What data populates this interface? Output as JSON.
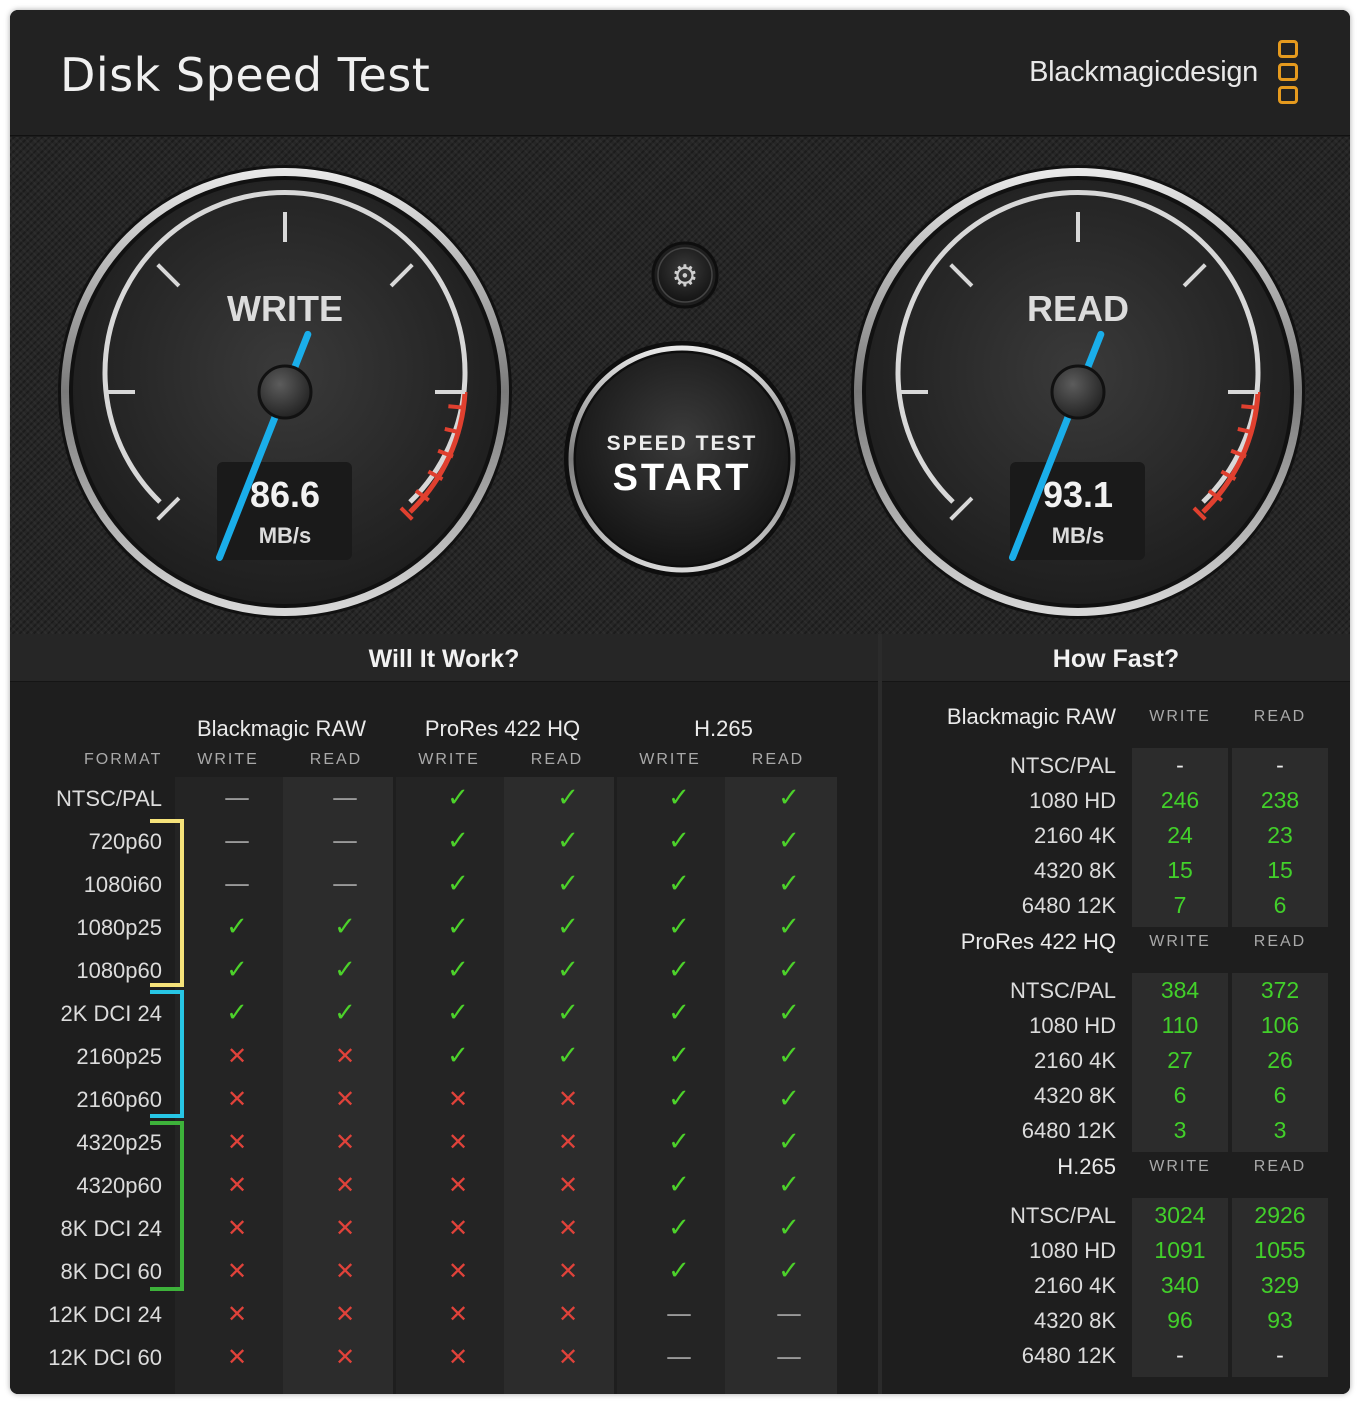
{
  "window": {
    "title": "Disk Speed Test",
    "brand": "Blackmagicdesign",
    "close_label": "✕"
  },
  "gauges": {
    "write": {
      "label": "WRITE",
      "value": "86.6",
      "unit": "MB/s",
      "needle_fraction": 0.58
    },
    "read": {
      "label": "READ",
      "value": "93.1",
      "unit": "MB/s",
      "needle_fraction": 0.58
    },
    "start_button": {
      "top_label": "SPEED TEST",
      "main_label": "START"
    },
    "settings_icon": "gear-icon"
  },
  "colors": {
    "needle": "#1aaeea",
    "check": "#4cd12a",
    "cross": "#e0423a",
    "fast_value": "#42d02a",
    "redline": "#e0402f",
    "brand_accent": "#e59a1e",
    "bracket_yellow": "#f5e27a",
    "bracket_cyan": "#27c6e5",
    "bracket_green": "#3db23a"
  },
  "will_it_work": {
    "title": "Will It Work?",
    "format_header": "FORMAT",
    "codecs": [
      "Blackmagic RAW",
      "ProRes 422 HQ",
      "H.265"
    ],
    "columns": [
      "WRITE",
      "READ",
      "WRITE",
      "READ",
      "WRITE",
      "READ"
    ],
    "rows": [
      {
        "format": "NTSC/PAL",
        "marks": [
          "na",
          "na",
          "yes",
          "yes",
          "yes",
          "yes"
        ]
      },
      {
        "format": "720p60",
        "marks": [
          "na",
          "na",
          "yes",
          "yes",
          "yes",
          "yes"
        ]
      },
      {
        "format": "1080i60",
        "marks": [
          "na",
          "na",
          "yes",
          "yes",
          "yes",
          "yes"
        ]
      },
      {
        "format": "1080p25",
        "marks": [
          "yes",
          "yes",
          "yes",
          "yes",
          "yes",
          "yes"
        ]
      },
      {
        "format": "1080p60",
        "marks": [
          "yes",
          "yes",
          "yes",
          "yes",
          "yes",
          "yes"
        ]
      },
      {
        "format": "2K DCI 24",
        "marks": [
          "yes",
          "yes",
          "yes",
          "yes",
          "yes",
          "yes"
        ]
      },
      {
        "format": "2160p25",
        "marks": [
          "no",
          "no",
          "yes",
          "yes",
          "yes",
          "yes"
        ]
      },
      {
        "format": "2160p60",
        "marks": [
          "no",
          "no",
          "no",
          "no",
          "yes",
          "yes"
        ]
      },
      {
        "format": "4320p25",
        "marks": [
          "no",
          "no",
          "no",
          "no",
          "yes",
          "yes"
        ]
      },
      {
        "format": "4320p60",
        "marks": [
          "no",
          "no",
          "no",
          "no",
          "yes",
          "yes"
        ]
      },
      {
        "format": "8K DCI 24",
        "marks": [
          "no",
          "no",
          "no",
          "no",
          "yes",
          "yes"
        ]
      },
      {
        "format": "8K DCI 60",
        "marks": [
          "no",
          "no",
          "no",
          "no",
          "yes",
          "yes"
        ]
      },
      {
        "format": "12K DCI 24",
        "marks": [
          "no",
          "no",
          "no",
          "no",
          "na",
          "na"
        ]
      },
      {
        "format": "12K DCI 60",
        "marks": [
          "no",
          "no",
          "no",
          "no",
          "na",
          "na"
        ]
      }
    ],
    "glyphs": {
      "yes": "✓",
      "no": "✕",
      "na": "—"
    }
  },
  "how_fast": {
    "title": "How Fast?",
    "groups": [
      {
        "codec": "Blackmagic RAW",
        "write_header": "WRITE",
        "read_header": "READ",
        "rows": [
          {
            "format": "NTSC/PAL",
            "write": "-",
            "read": "-"
          },
          {
            "format": "1080 HD",
            "write": "246",
            "read": "238"
          },
          {
            "format": "2160 4K",
            "write": "24",
            "read": "23"
          },
          {
            "format": "4320 8K",
            "write": "15",
            "read": "15"
          },
          {
            "format": "6480 12K",
            "write": "7",
            "read": "6"
          }
        ]
      },
      {
        "codec": "ProRes 422 HQ",
        "write_header": "WRITE",
        "read_header": "READ",
        "rows": [
          {
            "format": "NTSC/PAL",
            "write": "384",
            "read": "372"
          },
          {
            "format": "1080 HD",
            "write": "110",
            "read": "106"
          },
          {
            "format": "2160 4K",
            "write": "27",
            "read": "26"
          },
          {
            "format": "4320 8K",
            "write": "6",
            "read": "6"
          },
          {
            "format": "6480 12K",
            "write": "3",
            "read": "3"
          }
        ]
      },
      {
        "codec": "H.265",
        "write_header": "WRITE",
        "read_header": "READ",
        "rows": [
          {
            "format": "NTSC/PAL",
            "write": "3024",
            "read": "2926"
          },
          {
            "format": "1080 HD",
            "write": "1091",
            "read": "1055"
          },
          {
            "format": "2160 4K",
            "write": "340",
            "read": "329"
          },
          {
            "format": "4320 8K",
            "write": "96",
            "read": "93"
          },
          {
            "format": "6480 12K",
            "write": "-",
            "read": "-"
          }
        ]
      }
    ]
  }
}
